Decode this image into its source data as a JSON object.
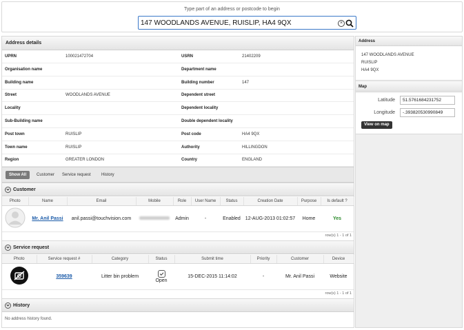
{
  "search": {
    "hint": "Type part of an address or postcode to begin",
    "value": "147 WOODLANDS AVENUE, RUISLIP, HA4 9QX",
    "clear_icon": "clear-icon",
    "search_icon": "search-icon"
  },
  "address_details": {
    "title": "Address details",
    "rows": [
      {
        "l1": "UPRN",
        "v1": "100021472704",
        "l2": "USRN",
        "v2": "21402209"
      },
      {
        "l1": "Organisation name",
        "v1": "",
        "l2": "Department name",
        "v2": ""
      },
      {
        "l1": "Building name",
        "v1": "",
        "l2": "Building number",
        "v2": "147"
      },
      {
        "l1": "Street",
        "v1": "WOODLANDS AVENUE",
        "l2": "Dependent street",
        "v2": ""
      },
      {
        "l1": "Locality",
        "v1": "",
        "l2": "Dependent locality",
        "v2": ""
      },
      {
        "l1": "Sub-Building name",
        "v1": "",
        "l2": "Double dependent locality",
        "v2": ""
      },
      {
        "l1": "Post town",
        "v1": "RUISLIP",
        "l2": "Post code",
        "v2": "HA4 9QX"
      },
      {
        "l1": "Town name",
        "v1": "RUISLIP",
        "l2": "Authority",
        "v2": "HILLINGDON"
      },
      {
        "l1": "Region",
        "v1": "GREATER LONDON",
        "l2": "Country",
        "v2": "ENGLAND"
      }
    ]
  },
  "region_tabs": [
    "Show All",
    "Customer",
    "Service request",
    "History"
  ],
  "customer": {
    "title": "Customer",
    "columns": [
      "Photo",
      "Name",
      "Email",
      "Mobile",
      "Role",
      "User Name",
      "Status",
      "Creation Date",
      "Purpose",
      "Is default ?"
    ],
    "row": {
      "name": "Mr. Anil Passi",
      "email": "anil.passi@touchvision.com",
      "role": "Admin",
      "user_name": "-",
      "status": "Enabled",
      "creation_date": "12-AUG-2013 01:02:57",
      "purpose": "Home",
      "is_default": "Yes"
    },
    "rowcount": "row(s) 1 - 1 of 1"
  },
  "service_request": {
    "title": "Service request",
    "columns": [
      "Photo",
      "Service request #",
      "Category",
      "Status",
      "Submit time",
      "Priority",
      "Customer",
      "Device"
    ],
    "row": {
      "number": "359639",
      "category": "Litter bin problem",
      "status": "Open",
      "submit_time": "15-DEC-2015 11:14:02",
      "priority": "-",
      "customer": "Mr. Anil Passi",
      "device": "Website"
    },
    "rowcount": "row(s) 1 - 1 of 1"
  },
  "history": {
    "title": "History",
    "empty": "No address history found."
  },
  "side": {
    "address_title": "Address",
    "address_lines": [
      "147 WOODLANDS AVENUE",
      "RUISLIP",
      "HA4 9QX"
    ],
    "map_title": "Map",
    "latitude_label": "Latitude",
    "latitude": "51.5761684231752",
    "longitude_label": "Longitude",
    "longitude": "-.393820530990849",
    "view_map": "View on map"
  },
  "colors": {
    "accent": "#3a78c8",
    "link": "#1a5aa8",
    "yes": "#2a8a2a"
  }
}
